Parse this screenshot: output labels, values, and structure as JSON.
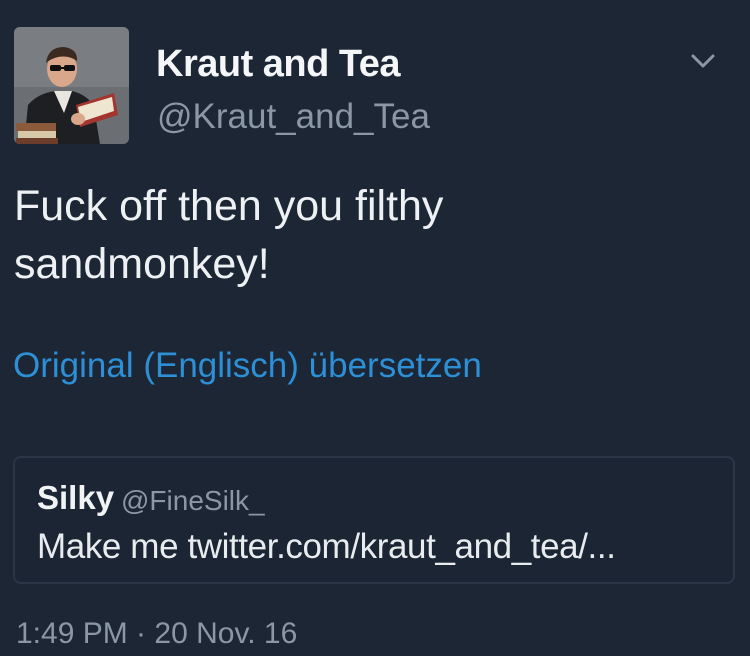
{
  "tweet": {
    "author": {
      "name": "Kraut and Tea",
      "handle": "@Kraut_and_Tea"
    },
    "text_line1": "Fuck off then you filthy",
    "text_line2": "sandmonkey!",
    "translate_link": "Original (Englisch) übersetzen",
    "quoted": {
      "name": "Silky",
      "handle": "@FineSilk_",
      "text": "Make me twitter.com/kraut_and_tea/..."
    },
    "timestamp": "1:49 PM · 20 Nov. 16"
  },
  "icons": {
    "menu": "chevron-down-icon",
    "avatar": "avatar"
  },
  "colors": {
    "background": "#1c2634",
    "link": "#2d8fd6",
    "secondary_text": "#8b97a5",
    "primary_text": "#eef1f4"
  }
}
